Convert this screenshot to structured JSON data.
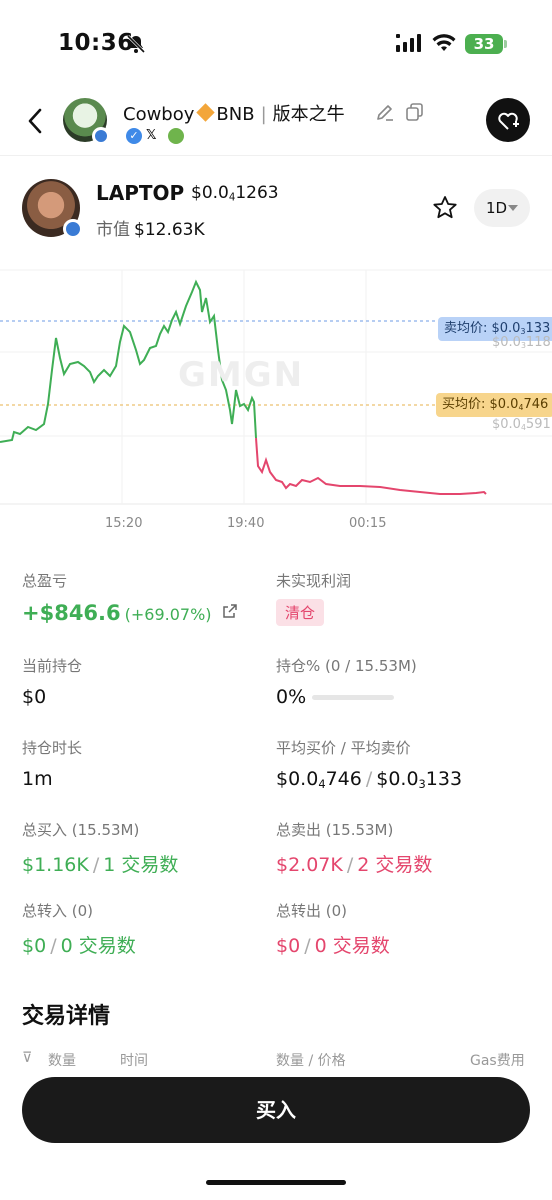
{
  "status_bar": {
    "time": "10:36",
    "battery": "33"
  },
  "header": {
    "owner_name": "Cowboy",
    "chain": "BNB",
    "tag": "版本之牛"
  },
  "token": {
    "name": "LAPTOP",
    "price_prefix": "$0.0",
    "price_sub": "4",
    "price_rest": "1263",
    "mcap_label": "市值",
    "mcap_value": "$12.63K",
    "timeframe": "1D"
  },
  "chart": {
    "watermark": "GMGN",
    "sell_pill": {
      "prefix": "卖均价: $0.0",
      "sub": "3",
      "rest": "133"
    },
    "buy_pill": {
      "prefix": "买均价: $0.0",
      "sub": "4",
      "rest": "746"
    },
    "ghost_top": {
      "prefix": "$0.0",
      "sub": "3",
      "rest": "118"
    },
    "ghost_bottom": {
      "prefix": "$0.0",
      "sub": "4",
      "rest": "591"
    },
    "x_ticks": [
      "15:20",
      "19:40",
      "00:15"
    ]
  },
  "chart_data": {
    "type": "line",
    "x_ticks": [
      "15:20",
      "19:40",
      "00:15"
    ],
    "series_colors": {
      "up": "#3fae55",
      "down": "#e4466d"
    },
    "avg_sell_line": "卖均价: $0.0₃133",
    "avg_buy_line": "买均价: $0.0₄746",
    "grid": true
  },
  "stats": {
    "total_pnl": {
      "label": "总盈亏",
      "value": "+$846.6",
      "pct": "(+69.07%)"
    },
    "unrealized": {
      "label": "未实现利润",
      "button": "清仓"
    },
    "holding": {
      "label": "当前持仓",
      "value": "$0"
    },
    "holding_pct": {
      "label": "持仓% (0 / 15.53M)",
      "value": "0%",
      "fill": 0
    },
    "hold_time": {
      "label": "持仓时长",
      "value": "1m"
    },
    "avg_price": {
      "label": "平均买价 / 平均卖价",
      "buy": {
        "prefix": "$0.0",
        "sub": "4",
        "rest": "746"
      },
      "sell": {
        "prefix": "$0.0",
        "sub": "3",
        "rest": "133"
      }
    },
    "total_buy": {
      "label": "总买入 (15.53M)",
      "amount": "$1.16K",
      "count": "1 交易数"
    },
    "total_sell": {
      "label": "总卖出 (15.53M)",
      "amount": "$2.07K",
      "count": "2 交易数"
    },
    "transfer_in": {
      "label": "总转入 (0)",
      "amount": "$0",
      "count": "0 交易数"
    },
    "transfer_out": {
      "label": "总转出 (0)",
      "amount": "$0",
      "count": "0 交易数"
    }
  },
  "trades": {
    "title": "交易详情",
    "col_1": "数量",
    "col_2": "时间",
    "col_3": "数量 / 价格",
    "col_4": "Gas费用"
  },
  "footer": {
    "buy_label": "买入"
  }
}
